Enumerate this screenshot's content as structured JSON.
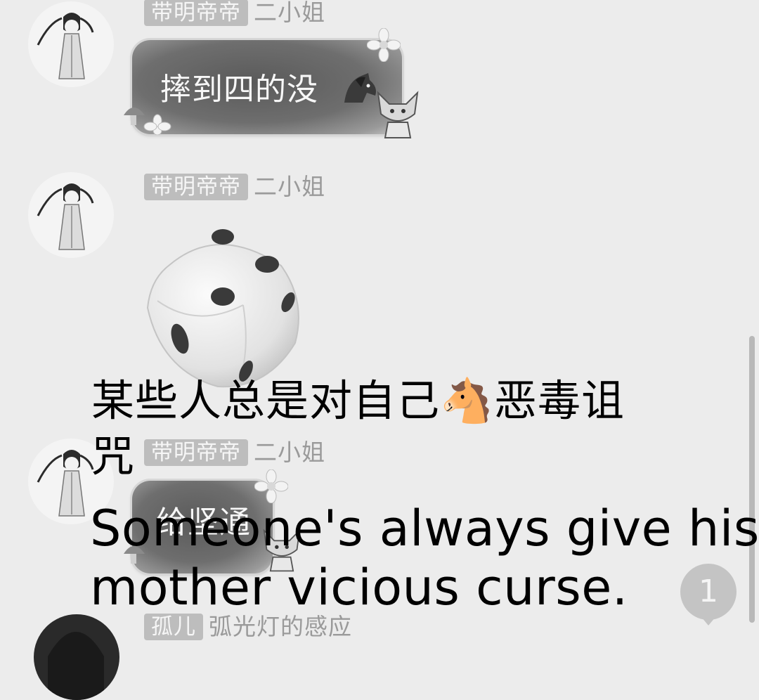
{
  "messages": [
    {
      "tag": "带明帝帝",
      "nickname": "二小姐",
      "text": "摔到四的没"
    },
    {
      "tag": "带明帝帝",
      "nickname": "二小姐",
      "dice_value": 5
    },
    {
      "tag": "带明帝帝",
      "nickname": "二小姐",
      "text": "给坚通"
    },
    {
      "tag": "孤儿",
      "nickname": "弧光灯的感应"
    }
  ],
  "overlay": {
    "chinese_line1": "某些人总是对自己🐴恶毒诅",
    "chinese_line2": "咒",
    "english_line1": "Someone's always give his",
    "english_line2": "mother vicious curse."
  },
  "unread_badge": {
    "count": "1"
  },
  "colors": {
    "background": "#ececec",
    "bubble": "#5a5a5a",
    "tag_bg": "#bdbdbd",
    "nickname": "#9a9a9a"
  },
  "icons": [
    "girl-avatar",
    "horse-emoji",
    "dice",
    "flower-decoration",
    "mushroom-decoration",
    "fox-mascot"
  ]
}
